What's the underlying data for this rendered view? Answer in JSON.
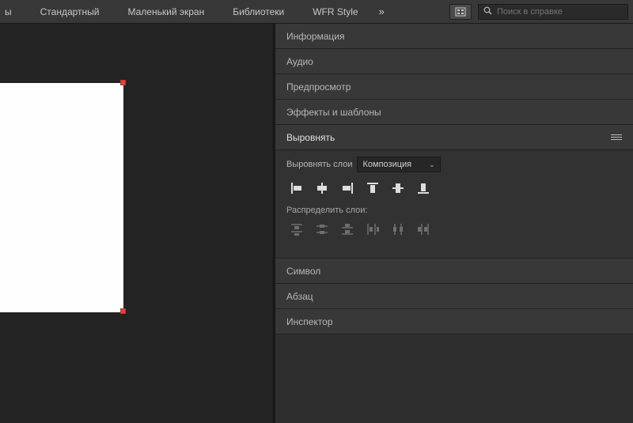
{
  "topbar": {
    "tabs": [
      "ы",
      "Стандартный",
      "Маленький экран",
      "Библиотеки",
      "WFR Style"
    ],
    "search_placeholder": "Поиск в справке"
  },
  "panels": {
    "info": "Информация",
    "audio": "Аудио",
    "preview": "Предпросмотр",
    "effects": "Эффекты и шаблоны",
    "align": "Выровнять",
    "character": "Символ",
    "paragraph": "Абзац",
    "inspector": "Инспектор"
  },
  "align": {
    "align_layers_label": "Выровнять слои",
    "align_to": "Композиция",
    "distribute_label": "Распределить слои:"
  }
}
